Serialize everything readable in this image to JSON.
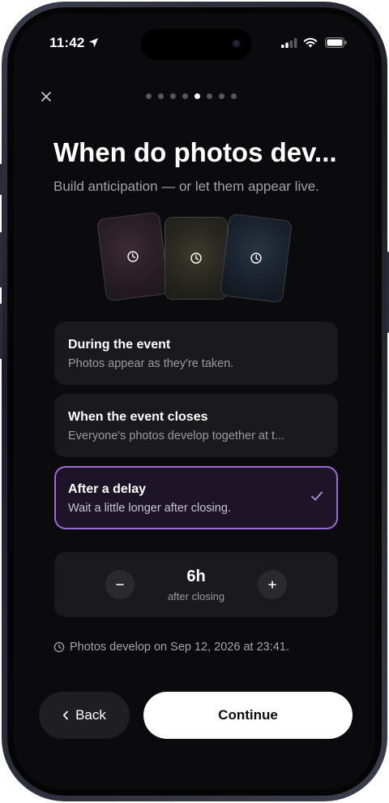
{
  "status_bar": {
    "time": "11:42"
  },
  "header": {
    "step_total": 8,
    "step_active": 4
  },
  "title": "When do photos dev...",
  "subtitle": "Build anticipation — or let them appear live.",
  "options": [
    {
      "title": "During the event",
      "description": "Photos appear as they're taken.",
      "selected": false
    },
    {
      "title": "When the event closes",
      "description": "Everyone's photos develop together at t...",
      "selected": false
    },
    {
      "title": "After a delay",
      "description": "Wait a little longer after closing.",
      "selected": true
    }
  ],
  "delay": {
    "value": "6h",
    "unit_label": "after closing"
  },
  "develop_note": "Photos develop on Sep 12, 2026 at 23:41.",
  "buttons": {
    "back": "Back",
    "continue": "Continue"
  },
  "colors": {
    "accent": "#9c6ad8",
    "background": "#0b0b0d",
    "card": "#1a1a1d"
  }
}
